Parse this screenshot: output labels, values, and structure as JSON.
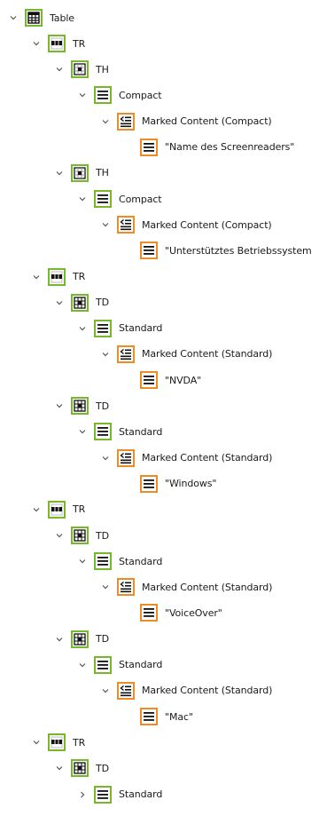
{
  "nodes": [
    {
      "label": "Table",
      "level": 0,
      "expander": "expanded",
      "icon": "table-icon",
      "border": "#76b82a"
    },
    {
      "label": "TR",
      "level": 1,
      "expander": "expanded",
      "icon": "table-row-icon",
      "border": "#76b82a"
    },
    {
      "label": "TH",
      "level": 2,
      "expander": "expanded",
      "icon": "table-header-cell-icon",
      "border": "#76b82a"
    },
    {
      "label": "Compact",
      "level": 3,
      "expander": "expanded",
      "icon": "paragraph-icon",
      "border": "#76b82a"
    },
    {
      "label": "Marked Content (Compact)",
      "level": 4,
      "expander": "expanded",
      "icon": "marked-content-icon",
      "border": "#f08a24"
    },
    {
      "label": "\"Name des Screenreaders\"",
      "level": 5,
      "expander": "none",
      "icon": "text-icon",
      "border": "#f08a24"
    },
    {
      "label": "TH",
      "level": 2,
      "expander": "expanded",
      "icon": "table-header-cell-icon",
      "border": "#76b82a"
    },
    {
      "label": "Compact",
      "level": 3,
      "expander": "expanded",
      "icon": "paragraph-icon",
      "border": "#76b82a"
    },
    {
      "label": "Marked Content (Compact)",
      "level": 4,
      "expander": "expanded",
      "icon": "marked-content-icon",
      "border": "#f08a24"
    },
    {
      "label": "\"Unterstütztes Betriebssystem",
      "level": 5,
      "expander": "none",
      "icon": "text-icon",
      "border": "#f08a24"
    },
    {
      "label": "TR",
      "level": 1,
      "expander": "expanded",
      "icon": "table-row-icon",
      "border": "#76b82a"
    },
    {
      "label": "TD",
      "level": 2,
      "expander": "expanded",
      "icon": "table-data-cell-icon",
      "border": "#76b82a"
    },
    {
      "label": "Standard",
      "level": 3,
      "expander": "expanded",
      "icon": "paragraph-icon",
      "border": "#76b82a"
    },
    {
      "label": "Marked Content (Standard)",
      "level": 4,
      "expander": "expanded",
      "icon": "marked-content-icon",
      "border": "#f08a24"
    },
    {
      "label": "\"NVDA\"",
      "level": 5,
      "expander": "none",
      "icon": "text-icon",
      "border": "#f08a24"
    },
    {
      "label": "TD",
      "level": 2,
      "expander": "expanded",
      "icon": "table-data-cell-icon",
      "border": "#76b82a"
    },
    {
      "label": "Standard",
      "level": 3,
      "expander": "expanded",
      "icon": "paragraph-icon",
      "border": "#76b82a"
    },
    {
      "label": "Marked Content (Standard)",
      "level": 4,
      "expander": "expanded",
      "icon": "marked-content-icon",
      "border": "#f08a24"
    },
    {
      "label": "\"Windows\"",
      "level": 5,
      "expander": "none",
      "icon": "text-icon",
      "border": "#f08a24"
    },
    {
      "label": "TR",
      "level": 1,
      "expander": "expanded",
      "icon": "table-row-icon",
      "border": "#76b82a"
    },
    {
      "label": "TD",
      "level": 2,
      "expander": "expanded",
      "icon": "table-data-cell-icon",
      "border": "#76b82a"
    },
    {
      "label": "Standard",
      "level": 3,
      "expander": "expanded",
      "icon": "paragraph-icon",
      "border": "#76b82a"
    },
    {
      "label": "Marked Content (Standard)",
      "level": 4,
      "expander": "expanded",
      "icon": "marked-content-icon",
      "border": "#f08a24"
    },
    {
      "label": "\"VoiceOver\"",
      "level": 5,
      "expander": "none",
      "icon": "text-icon",
      "border": "#f08a24"
    },
    {
      "label": "TD",
      "level": 2,
      "expander": "expanded",
      "icon": "table-data-cell-icon",
      "border": "#76b82a"
    },
    {
      "label": "Standard",
      "level": 3,
      "expander": "expanded",
      "icon": "paragraph-icon",
      "border": "#76b82a"
    },
    {
      "label": "Marked Content (Standard)",
      "level": 4,
      "expander": "expanded",
      "icon": "marked-content-icon",
      "border": "#f08a24"
    },
    {
      "label": "\"Mac\"",
      "level": 5,
      "expander": "none",
      "icon": "text-icon",
      "border": "#f08a24"
    },
    {
      "label": "TR",
      "level": 1,
      "expander": "expanded",
      "icon": "table-row-icon",
      "border": "#76b82a"
    },
    {
      "label": "TD",
      "level": 2,
      "expander": "expanded",
      "icon": "table-data-cell-icon",
      "border": "#76b82a"
    },
    {
      "label": "Standard",
      "level": 3,
      "expander": "collapsed",
      "icon": "paragraph-icon",
      "border": "#76b82a"
    }
  ]
}
